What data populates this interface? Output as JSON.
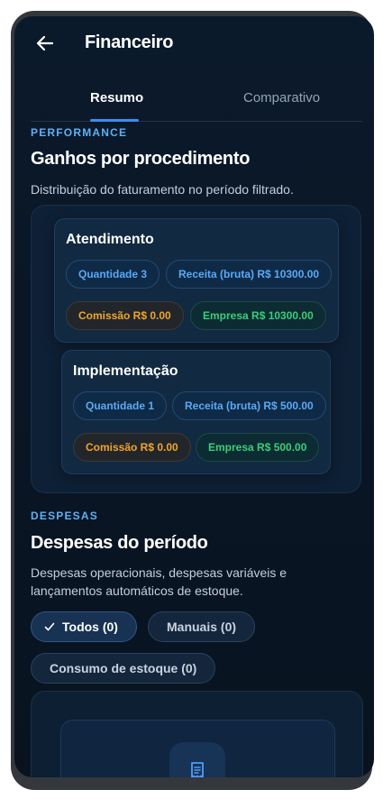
{
  "app_bar": {
    "title": "Financeiro"
  },
  "tabs": [
    {
      "label": "Resumo",
      "active": true
    },
    {
      "label": "Comparativo",
      "active": false
    }
  ],
  "performance": {
    "label": "PERFORMANCE",
    "title": "Ganhos por procedimento",
    "description": "Distribuição do faturamento no período filtrado.",
    "procedures": [
      {
        "name": "Atendimento",
        "quantidade": "Quantidade 3",
        "receita": "Receita (bruta) R$ 10300.00",
        "comissao": "Comissão R$ 0.00",
        "empresa": "Empresa R$ 10300.00"
      },
      {
        "name": "Implementação",
        "quantidade": "Quantidade 1",
        "receita": "Receita (bruta) R$ 500.00",
        "comissao": "Comissão R$ 0.00",
        "empresa": "Empresa R$ 500.00"
      }
    ]
  },
  "despesas": {
    "label": "DESPESAS",
    "title": "Despesas do período",
    "description": "Despesas operacionais, despesas variáveis e lançamentos automáticos de estoque.",
    "filters": [
      {
        "label": "Todos (0)",
        "selected": true
      },
      {
        "label": "Manuais (0)",
        "selected": false
      },
      {
        "label": "Consumo de estoque (0)",
        "selected": false
      }
    ],
    "empty_icon": "receipt-icon"
  },
  "colors": {
    "accent": "#3b8cf0",
    "label_blue": "#5fb0f4",
    "commission_orange": "#f0a52a",
    "company_green": "#37cf7a"
  }
}
